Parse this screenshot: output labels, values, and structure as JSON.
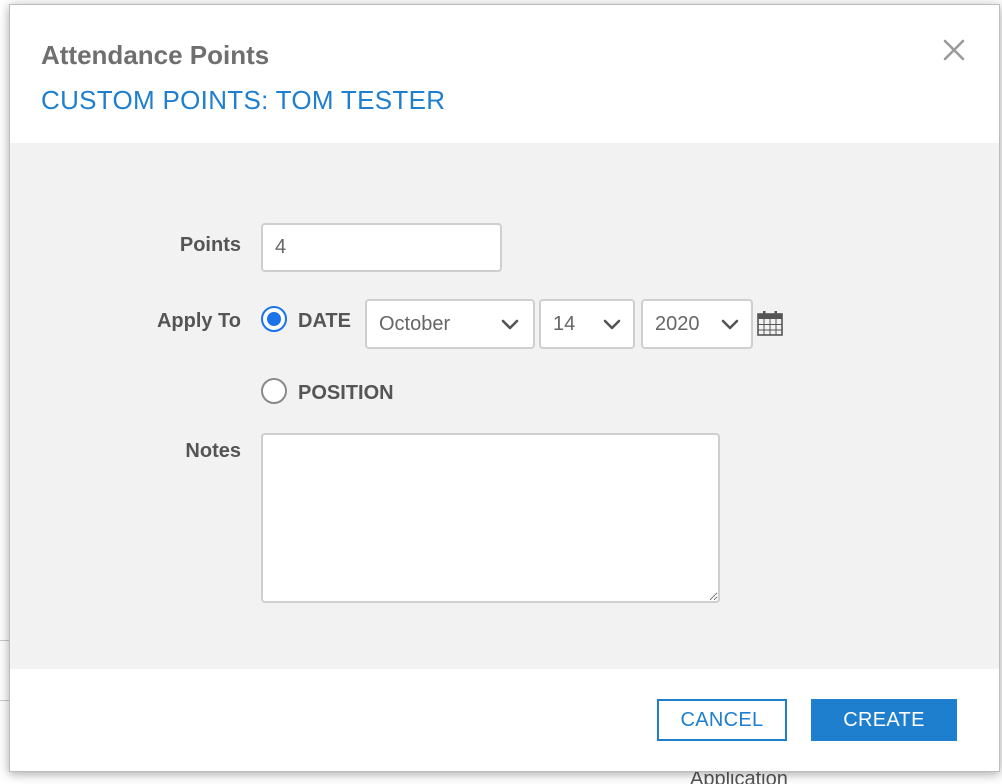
{
  "modal": {
    "title": "Attendance Points",
    "subtitle": "CUSTOM POINTS: TOM TESTER"
  },
  "form": {
    "points": {
      "label": "Points",
      "value": "4"
    },
    "apply_to": {
      "label": "Apply To",
      "options": [
        {
          "label": "DATE",
          "checked": true
        },
        {
          "label": "POSITION",
          "checked": false
        }
      ],
      "month": "October",
      "day": "14",
      "year": "2020"
    },
    "notes": {
      "label": "Notes",
      "value": ""
    }
  },
  "footer": {
    "cancel_label": "CANCEL",
    "create_label": "CREATE"
  },
  "background": {
    "partial_text": "Application"
  },
  "colors": {
    "accent": "#1e7fcf",
    "radio": "#1a73e8",
    "body_bg": "#f2f2f2",
    "label": "#555555"
  },
  "icons": {
    "close": "close-icon",
    "chevron": "chevron-down-icon",
    "calendar": "calendar-icon"
  }
}
